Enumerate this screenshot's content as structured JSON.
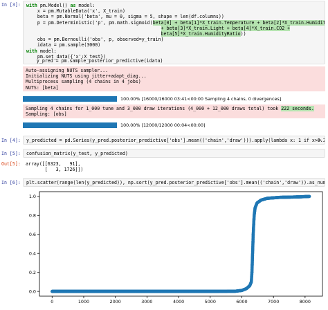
{
  "cells": {
    "c3": {
      "prompt": "In [3]:",
      "code": {
        "l1_kw": "with",
        "l1_rest": " pm.Model() ",
        "l1_as": "as",
        "l1_end": " model:",
        "l2": "    x = pm.MutableData('x', X_train)",
        "l3": "    beta = pm.Normal('beta', mu = 0, sigma = 5, shape = len(df.columns))",
        "l4_a": "    p = pm.Deterministic('p', pm.math.sigmoid(",
        "l4_hl": "beta[0] + beta[1]*X_train.Temperature + beta[2]*X_train.Humidity",
        "l5_hl": "+ beta[3]*X_train.Light + beta[4]*X_train.CO2 +",
        "l6_hl": "beta[5]*X_train.HumidityRatio",
        "l6_end": "))",
        "l7": "    obs = pm.Bernoulli('obs', p, observed=y_train)",
        "l8": "    idata = pm.sample(3000)",
        "l9": "",
        "l10_kw": "with",
        "l10_rest": " model:",
        "l11": "    pm.set_data({'x':X_test})",
        "l12": "    y_pred = pm.sample_posterior_predictive(idata)"
      },
      "stderr_1": [
        "Auto-assigning NUTS sampler...",
        "Initializing NUTS using jitter+adapt_diag...",
        "Multiprocess sampling (4 chains in 4 jobs)",
        "NUTS: [beta]"
      ],
      "progress_1": {
        "percent": 100,
        "label": "100.00% [16000/16000 03:41<00:00 Sampling 4 chains, 0 divergences]"
      },
      "stderr_2": {
        "line1_a": "Sampling 4 chains for 1_000 tune and 3_000 draw iterations (4_000 + 12_000 draws total) took ",
        "line1_hl": "222 seconds.",
        "line2": "Sampling: [obs]"
      },
      "progress_2": {
        "percent": 100,
        "label": "100.00% [12000/12000 00:04<00:00]"
      }
    },
    "c4": {
      "prompt": "In [4]:",
      "code": "y_predicted = pd.Series(y_pred.posterior_predictive['obs'].mean(('chain','draw'))).apply(lambda x: 1 if x>0.3 else 0)"
    },
    "c5": {
      "prompt_in": "In [5]:",
      "prompt_out": "Out[5]:",
      "code": "confusion_matrix(y_test, y_predicted)",
      "output": [
        "array([[6323,   91],",
        "       [   3, 1726]])"
      ]
    },
    "c6": {
      "prompt": "In [6]:",
      "code": "plt.scatter(range(len(y_predicted)), np.sort(y_pred.posterior_predictive['obs'].mean(('chain','draw')).as_numpy()));"
    }
  },
  "colors": {
    "marker": "#1f77b4",
    "stderr_bg": "#fbdddd",
    "highlight": "#b5e3b0",
    "prompt_in": "#303f9f",
    "prompt_out": "#d84315"
  },
  "icons": {
    "scroll": "triangle-right-icon"
  },
  "chart_data": {
    "type": "scatter",
    "title": "",
    "xlabel": "",
    "ylabel": "",
    "xlim": [
      -400,
      8550
    ],
    "ylim": [
      -0.05,
      1.05
    ],
    "xticks": [
      0,
      1000,
      2000,
      3000,
      4000,
      5000,
      6000,
      7000,
      8000
    ],
    "yticks": [
      0.0,
      0.2,
      0.4,
      0.6,
      0.8,
      1.0
    ],
    "ytick_labels": [
      "0.0",
      "0.2",
      "0.4",
      "0.6",
      "0.8",
      "1.0"
    ],
    "grid": false,
    "n_points": 8143,
    "curve": [
      [
        0,
        0.0
      ],
      [
        1000,
        0.0
      ],
      [
        2000,
        0.0
      ],
      [
        3000,
        0.0
      ],
      [
        4000,
        0.0
      ],
      [
        5000,
        0.0
      ],
      [
        5800,
        0.002
      ],
      [
        6000,
        0.01
      ],
      [
        6150,
        0.03
      ],
      [
        6250,
        0.06
      ],
      [
        6300,
        0.1
      ],
      [
        6320,
        0.2
      ],
      [
        6330,
        0.3
      ],
      [
        6340,
        0.4
      ],
      [
        6350,
        0.5
      ],
      [
        6360,
        0.6
      ],
      [
        6375,
        0.7
      ],
      [
        6390,
        0.8
      ],
      [
        6420,
        0.88
      ],
      [
        6480,
        0.93
      ],
      [
        6600,
        0.96
      ],
      [
        6800,
        0.98
      ],
      [
        7200,
        0.99
      ],
      [
        7800,
        0.995
      ],
      [
        8142,
        1.0
      ]
    ]
  }
}
